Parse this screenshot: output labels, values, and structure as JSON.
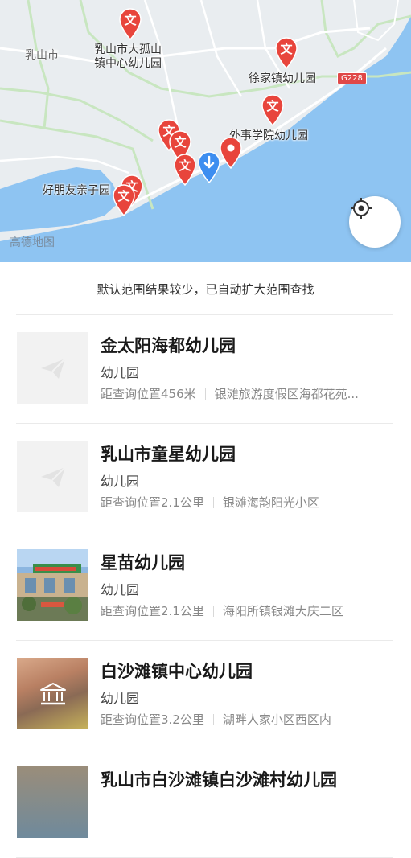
{
  "map": {
    "labels": {
      "rushan": "乳山市",
      "dagushan": "乳山市大孤山\n镇中心幼儿园",
      "xujiazhen": "徐家镇幼儿园",
      "waishi": "外事学院幼儿园",
      "haopengyou": "好朋友亲子园"
    },
    "road_badge": "G228",
    "watermark": "高德地图",
    "pin_glyph": "文",
    "colors": {
      "land": "#e9edf0",
      "water": "#8ec4f2",
      "road": "#ffffff",
      "highway": "#c8e6c0",
      "pin": "#e8453c",
      "current": "#3d8ef0"
    }
  },
  "notice": "默认范围结果较少，已自动扩大范围查找",
  "results": [
    {
      "title": "金太阳海都幼儿园",
      "category": "幼儿园",
      "distance": "距查询位置456米",
      "address": "银滩旅游度假区海都花苑...",
      "thumb": "placeholder-icon"
    },
    {
      "title": "乳山市童星幼儿园",
      "category": "幼儿园",
      "distance": "距查询位置2.1公里",
      "address": "银滩海韵阳光小区",
      "thumb": "placeholder-icon"
    },
    {
      "title": "星苗幼儿园",
      "category": "幼儿园",
      "distance": "距查询位置2.1公里",
      "address": "海阳所镇银滩大庆二区",
      "thumb": "photo"
    },
    {
      "title": "白沙滩镇中心幼儿园",
      "category": "幼儿园",
      "distance": "距查询位置3.2公里",
      "address": "湖畔人家小区西区内",
      "thumb": "building-icon"
    },
    {
      "title": "乳山市白沙滩镇白沙滩村幼儿园",
      "category": "",
      "distance": "",
      "address": "",
      "thumb": "photo"
    }
  ]
}
